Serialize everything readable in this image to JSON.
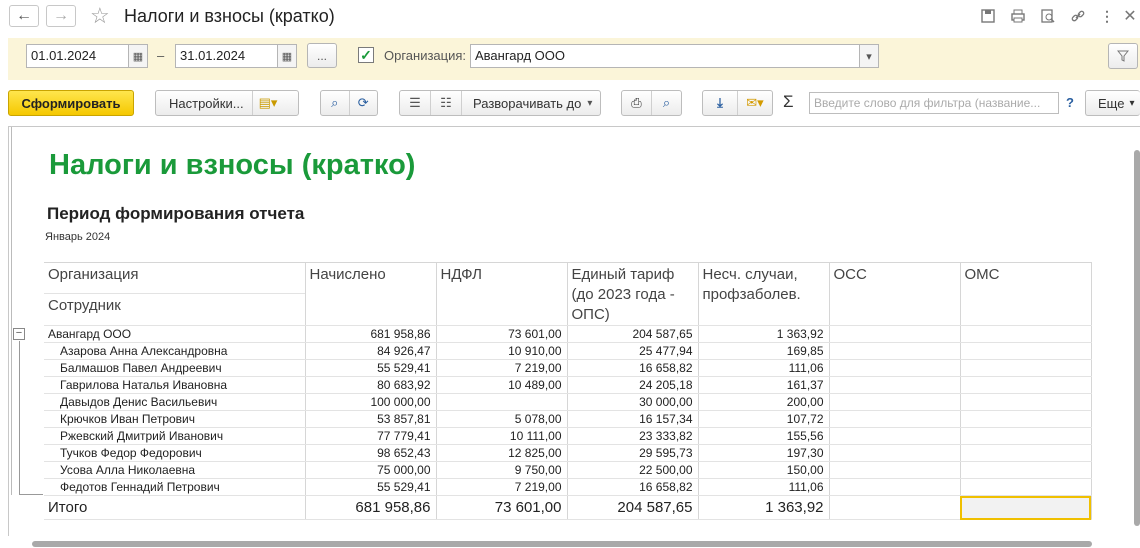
{
  "window": {
    "title": "Налоги и взносы (кратко)",
    "back": "←",
    "forward": "→",
    "star": "☆"
  },
  "params": {
    "date_from": "01.01.2024",
    "dash": "–",
    "date_to": "31.01.2024",
    "ellipsis": "...",
    "org_label": "Организация:",
    "org_value": "Авангард ООО",
    "org_checked": true
  },
  "toolbar": {
    "generate": "Сформировать",
    "settings": "Настройки...",
    "expand": "Разворачивать до",
    "more": "Еще",
    "search_placeholder": "Введите слово для фильтра (название...",
    "help": "?",
    "sigma": "Σ"
  },
  "report": {
    "title": "Налоги и взносы (кратко)",
    "period_heading": "Период формирования отчета",
    "period_value": "Январь 2024",
    "headers": {
      "org": "Организация",
      "employee": "Сотрудник",
      "accrued": "Начислено",
      "ndfl": "НДФЛ",
      "tariff": "Единый тариф (до 2023 года - ОПС)",
      "accident": "Несч. случаи, профзаболев.",
      "oss": "ОСС",
      "oms": "ОМС"
    },
    "group": {
      "name": "Авангард ООО",
      "accrued": "681 958,86",
      "ndfl": "73 601,00",
      "tariff": "204 587,65",
      "accident": "1 363,92"
    },
    "rows": [
      {
        "name": "Азарова Анна Александровна",
        "accrued": "84 926,47",
        "ndfl": "10 910,00",
        "tariff": "25 477,94",
        "accident": "169,85"
      },
      {
        "name": "Балмашов Павел Андреевич",
        "accrued": "55 529,41",
        "ndfl": "7 219,00",
        "tariff": "16 658,82",
        "accident": "111,06"
      },
      {
        "name": "Гаврилова Наталья Ивановна",
        "accrued": "80 683,92",
        "ndfl": "10 489,00",
        "tariff": "24 205,18",
        "accident": "161,37"
      },
      {
        "name": "Давыдов Денис Васильевич",
        "accrued": "100 000,00",
        "ndfl": "",
        "tariff": "30 000,00",
        "accident": "200,00"
      },
      {
        "name": "Крючков Иван Петрович",
        "accrued": "53 857,81",
        "ndfl": "5 078,00",
        "tariff": "16 157,34",
        "accident": "107,72"
      },
      {
        "name": "Ржевский Дмитрий Иванович",
        "accrued": "77 779,41",
        "ndfl": "10 111,00",
        "tariff": "23 333,82",
        "accident": "155,56"
      },
      {
        "name": "Тучков Федор Федорович",
        "accrued": "98 652,43",
        "ndfl": "12 825,00",
        "tariff": "29 595,73",
        "accident": "197,30"
      },
      {
        "name": "Усова Алла Николаевна",
        "accrued": "75 000,00",
        "ndfl": "9 750,00",
        "tariff": "22 500,00",
        "accident": "150,00"
      },
      {
        "name": "Федотов Геннадий Петрович",
        "accrued": "55 529,41",
        "ndfl": "7 219,00",
        "tariff": "16 658,82",
        "accident": "111,06"
      }
    ],
    "total": {
      "label": "Итого",
      "accrued": "681 958,86",
      "ndfl": "73 601,00",
      "tariff": "204 587,65",
      "accident": "1 363,92"
    }
  },
  "colors": {
    "accent_green": "#1a9a3a",
    "primary_yellow": "#f5c800",
    "param_bg": "#fbf5d9"
  }
}
